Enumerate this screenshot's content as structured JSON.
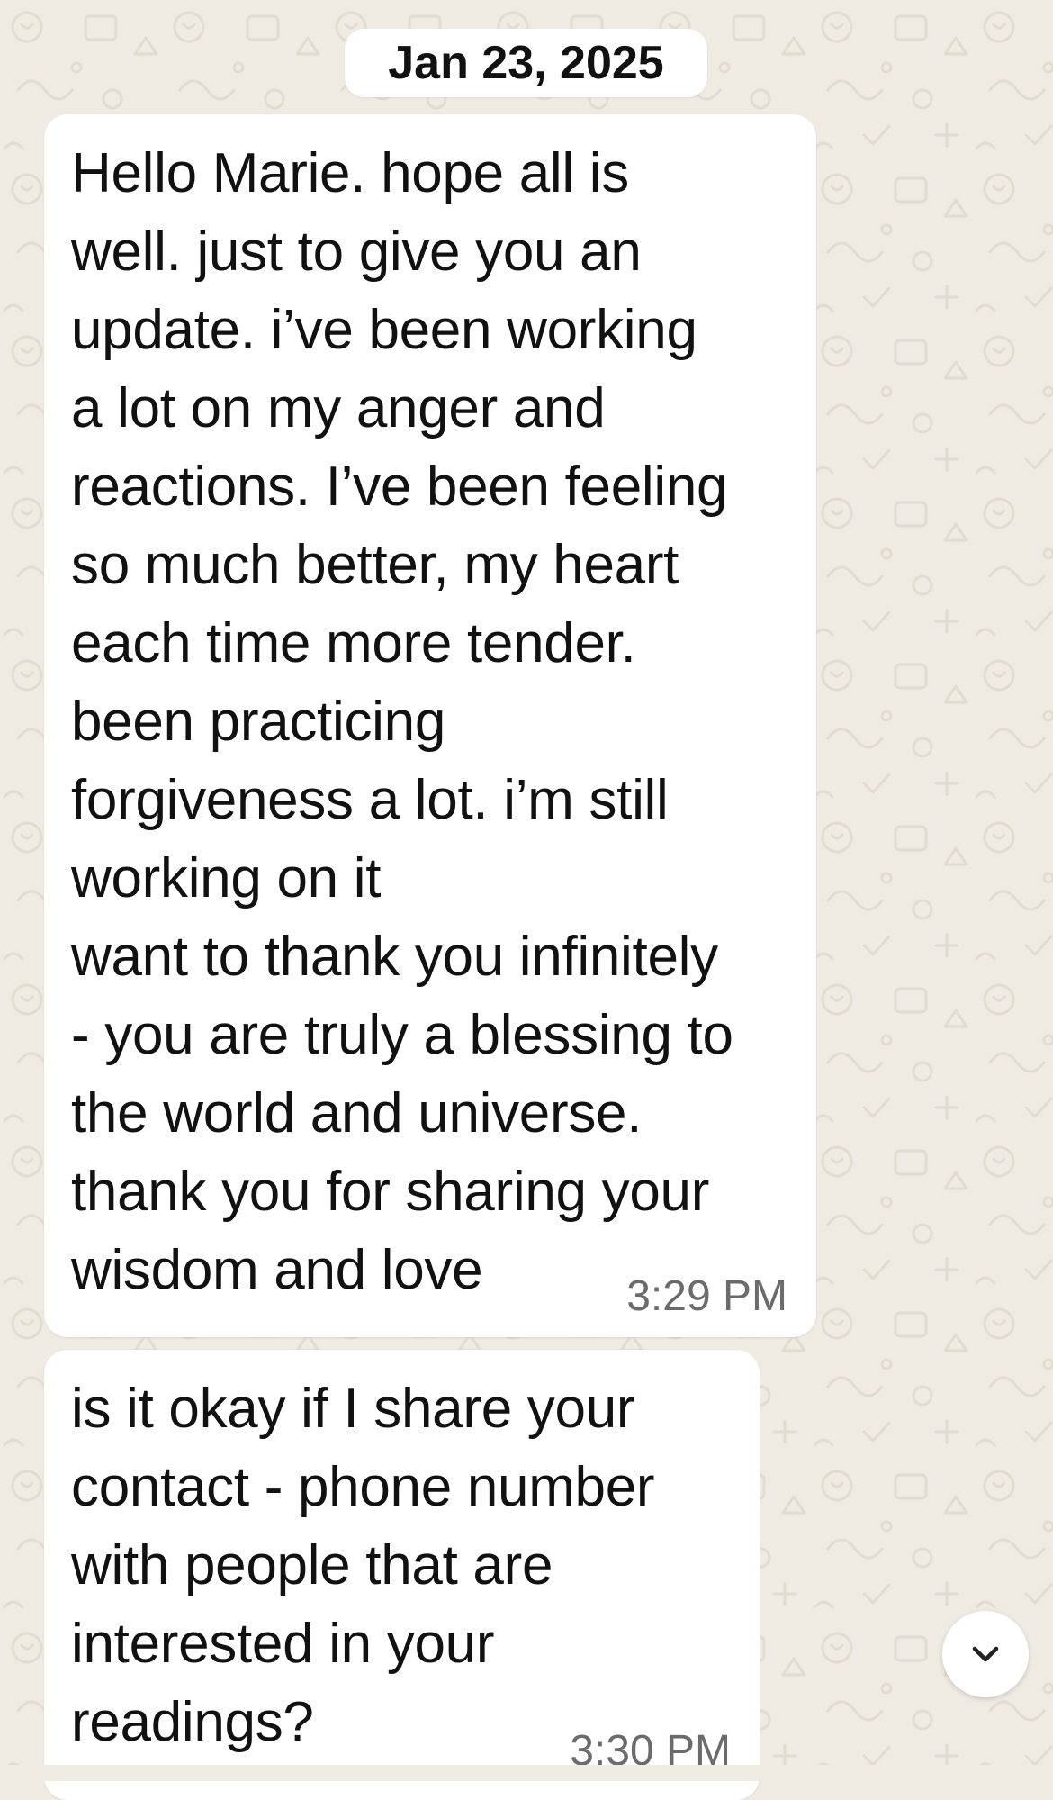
{
  "chat": {
    "date_separator": "Jan 23, 2025",
    "messages": [
      {
        "direction": "incoming",
        "text": "Hello Marie. hope all is\nwell. just to give you an\nupdate. i’ve been working\na lot on my anger and\nreactions. I’ve been feeling\nso much better, my heart\neach time more tender.\nbeen practicing\nforgiveness a lot. i’m still\nworking on it\nwant to thank you infinitely\n- you are truly a blessing to\nthe world and universe.\nthank you for sharing your\nwisdom and love",
        "time": "3:29 PM"
      },
      {
        "direction": "incoming",
        "text": "is it okay if I share your\ncontact - phone number\nwith people that are\ninterested in your\nreadings?",
        "time": "3:30 PM"
      }
    ]
  },
  "icons": {
    "scroll_down": "chevron-down-icon"
  },
  "colors": {
    "background": "#efeae2",
    "bubble": "#ffffff",
    "text": "#111111",
    "timestamp": "#6b6b6b"
  }
}
